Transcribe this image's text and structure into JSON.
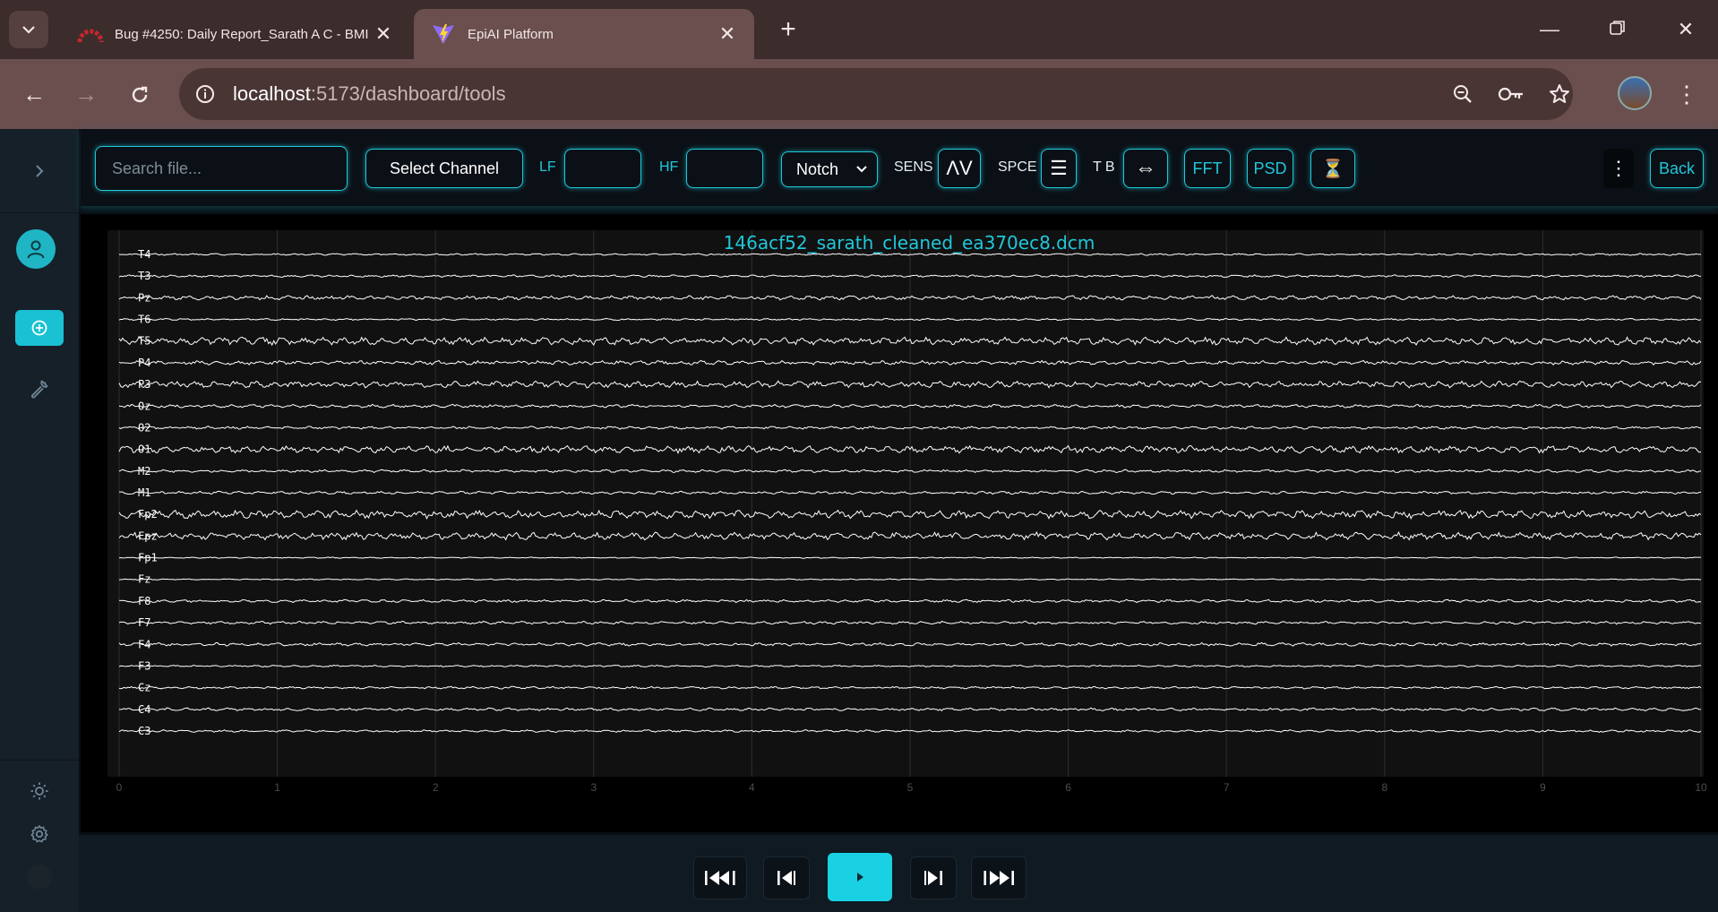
{
  "browser": {
    "tabs": [
      {
        "title": "Bug #4250: Daily Report_Sarath A C - BMI",
        "active": false,
        "favicon": "redmine-icon"
      },
      {
        "title": "EpiAI Platform",
        "active": true,
        "favicon": "vite-icon"
      }
    ],
    "url_host": "localhost",
    "url_path": ":5173/dashboard/tools",
    "colors": {
      "tabbar": "#3c2c2c",
      "toolbar": "#6b4f4f"
    }
  },
  "toolbar": {
    "search_placeholder": "Search file...",
    "select_channel_label": "Select Channel",
    "lf_label": "LF",
    "hf_label": "HF",
    "lf_value": "",
    "hf_value": "",
    "notch_label": "Notch",
    "sens_label": "SENS",
    "sens_icon": "ΛV",
    "spce_label": "SPCE",
    "spce_icon": "☰",
    "tb_label": "T B",
    "tb_icon": "⇔",
    "fft_label": "FFT",
    "psd_label": "PSD",
    "timer_icon": "⏳",
    "more_icon": "⋮",
    "back_label": "Back",
    "accent": "#20c7d9"
  },
  "chart_data": {
    "type": "line",
    "title": "146acf52_sarath_cleaned_ea370ec8.dcm",
    "channels": [
      "T4",
      "T3",
      "Pz",
      "T6",
      "T5",
      "P4",
      "P3",
      "Oz",
      "O2",
      "O1",
      "M2",
      "M1",
      "Fp2",
      "Fpz",
      "Fp1",
      "Fz",
      "F8",
      "F7",
      "F4",
      "F3",
      "Cz",
      "C4",
      "C3"
    ],
    "xlim": [
      0,
      10
    ],
    "xticks": [
      "0",
      "1",
      "2",
      "3",
      "4",
      "5",
      "6",
      "7",
      "8",
      "9",
      "10"
    ],
    "amplitude_relative": [
      0.2,
      0.25,
      0.45,
      0.2,
      0.8,
      0.45,
      0.7,
      0.35,
      0.3,
      0.75,
      0.3,
      0.3,
      0.85,
      0.8,
      0.12,
      0.12,
      0.3,
      0.3,
      0.35,
      0.2,
      0.25,
      0.3,
      0.25
    ],
    "grid": true,
    "line_color": "#ffffff",
    "background": "#111111"
  },
  "player": {
    "first_icon": "skip-to-start",
    "prev_icon": "step-back",
    "play_icon": "play",
    "next_icon": "step-forward",
    "last_icon": "skip-to-end",
    "accent": "#1ad1e3"
  }
}
